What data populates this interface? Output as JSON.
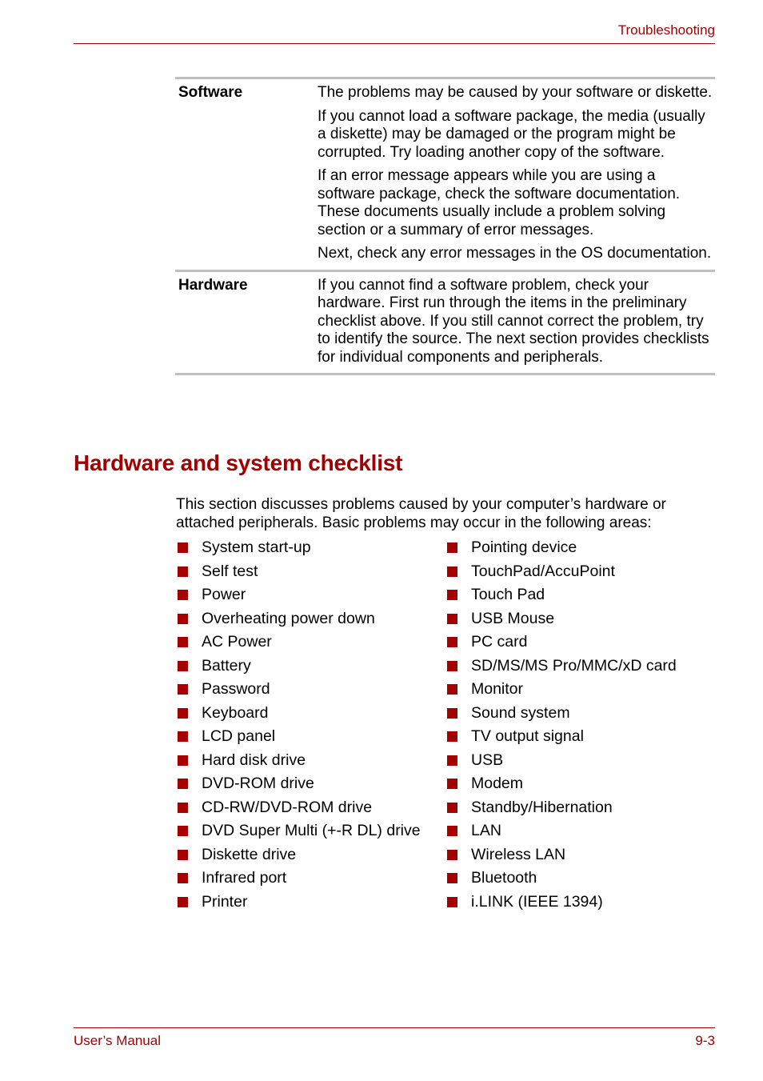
{
  "header": {
    "title": "Troubleshooting"
  },
  "table": {
    "rows": [
      {
        "label": "Software",
        "paragraphs": [
          "The problems may be caused by your software or diskette.",
          "If you cannot load a software package, the media (usually a diskette) may be damaged or the program might be corrupted. Try loading another copy of the software.",
          "If an error message appears while you are using a software package, check the software documentation. These documents usually include a problem solving section or a summary of error messages.",
          "Next, check any error messages in the OS documentation."
        ]
      },
      {
        "label": "Hardware",
        "paragraphs": [
          "If you cannot find a software problem, check your hardware. First run through the items in the preliminary checklist above. If you still cannot correct the problem, try to identify the source. The next section provides checklists for individual components and peripherals."
        ]
      }
    ]
  },
  "section": {
    "heading": "Hardware and system checklist",
    "intro": "This section discusses problems caused by your computer’s hardware or attached peripherals. Basic problems may occur in the following areas:",
    "left_items": [
      "System start-up",
      "Self test",
      "Power",
      "Overheating power down",
      "AC Power",
      "Battery",
      "Password",
      "Keyboard",
      "LCD panel",
      "Hard disk drive",
      "DVD-ROM drive",
      "CD-RW/DVD-ROM drive",
      "DVD Super Multi (+-R DL) drive",
      "Diskette drive",
      "Infrared port",
      "Printer"
    ],
    "right_items": [
      "Pointing device",
      "TouchPad/AccuPoint",
      "Touch Pad",
      "USB Mouse",
      "PC card",
      "SD/MS/MS Pro/MMC/xD card",
      "Monitor",
      "Sound system",
      "TV output signal",
      "USB",
      "Modem",
      "Standby/Hibernation",
      "LAN",
      "Wireless LAN",
      "Bluetooth",
      "i.LINK (IEEE 1394)"
    ]
  },
  "footer": {
    "left": "User’s Manual",
    "right": "9-3"
  },
  "colors": {
    "accent": "#a50000",
    "rule": "#c0c0c0"
  }
}
